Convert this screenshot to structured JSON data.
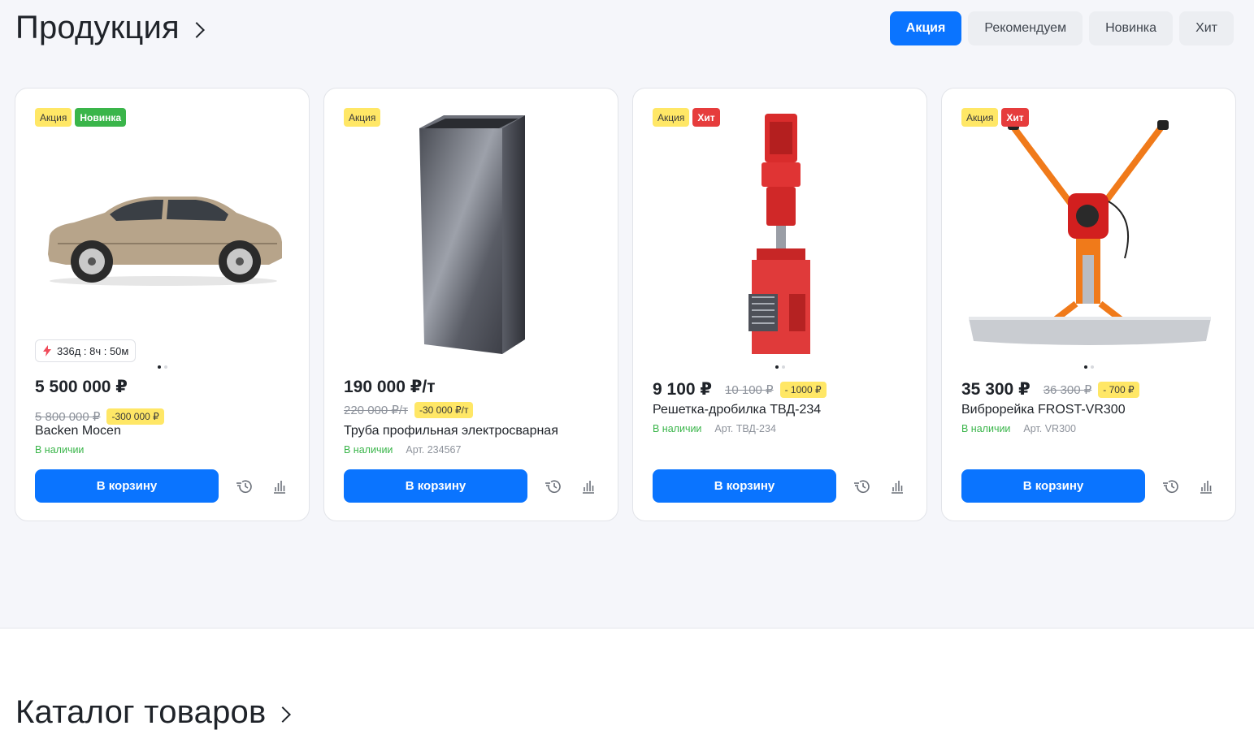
{
  "products": {
    "title": "Продукция",
    "filters": [
      "Акция",
      "Рекомендуем",
      "Новинка",
      "Хит"
    ],
    "cards": [
      {
        "badges": [
          {
            "label": "Акция",
            "kind": "sale"
          },
          {
            "label": "Новинка",
            "kind": "new"
          }
        ],
        "image_icon": "car-image",
        "timer": "336д : 8ч : 50м",
        "price": "5 500 000 ₽",
        "old_price": "5 800 000 ₽",
        "discount": "-300 000 ₽",
        "name": "Backen Mocen",
        "stock": "В наличии",
        "article": "",
        "cart_label": "В корзину"
      },
      {
        "badges": [
          {
            "label": "Акция",
            "kind": "sale"
          }
        ],
        "image_icon": "profile-pipe-image",
        "timer": "",
        "price": "190 000 ₽/т",
        "old_price": "220 000 ₽/т",
        "discount": "-30 000 ₽/т",
        "name": "Труба профильная электросварная",
        "stock": "В наличии",
        "article": "Арт. 234567",
        "cart_label": "В корзину"
      },
      {
        "badges": [
          {
            "label": "Акция",
            "kind": "sale"
          },
          {
            "label": "Хит",
            "kind": "hit"
          }
        ],
        "image_icon": "crusher-grate-image",
        "timer": "",
        "price": "9 100 ₽",
        "old_price": "10 100 ₽",
        "discount": "- 1000 ₽",
        "name": "Решетка-дробилка ТВД-234",
        "stock": "В наличии",
        "article": "Арт. ТВД-234",
        "cart_label": "В корзину"
      },
      {
        "badges": [
          {
            "label": "Акция",
            "kind": "sale"
          },
          {
            "label": "Хит",
            "kind": "hit"
          }
        ],
        "image_icon": "vibro-screed-image",
        "timer": "",
        "price": "35 300 ₽",
        "old_price": "36 300 ₽",
        "discount": "- 700 ₽",
        "name": "Виброрейка FROST-VR300",
        "stock": "В наличии",
        "article": "Арт. VR300",
        "cart_label": "В корзину"
      }
    ]
  },
  "catalog": {
    "title": "Каталог товаров"
  },
  "colors": {
    "accent": "#0a74ff",
    "sale_badge": "#ffe766",
    "new_badge": "#3ab54a",
    "hit_badge": "#e63c3c",
    "in_stock": "#3ab54a"
  }
}
